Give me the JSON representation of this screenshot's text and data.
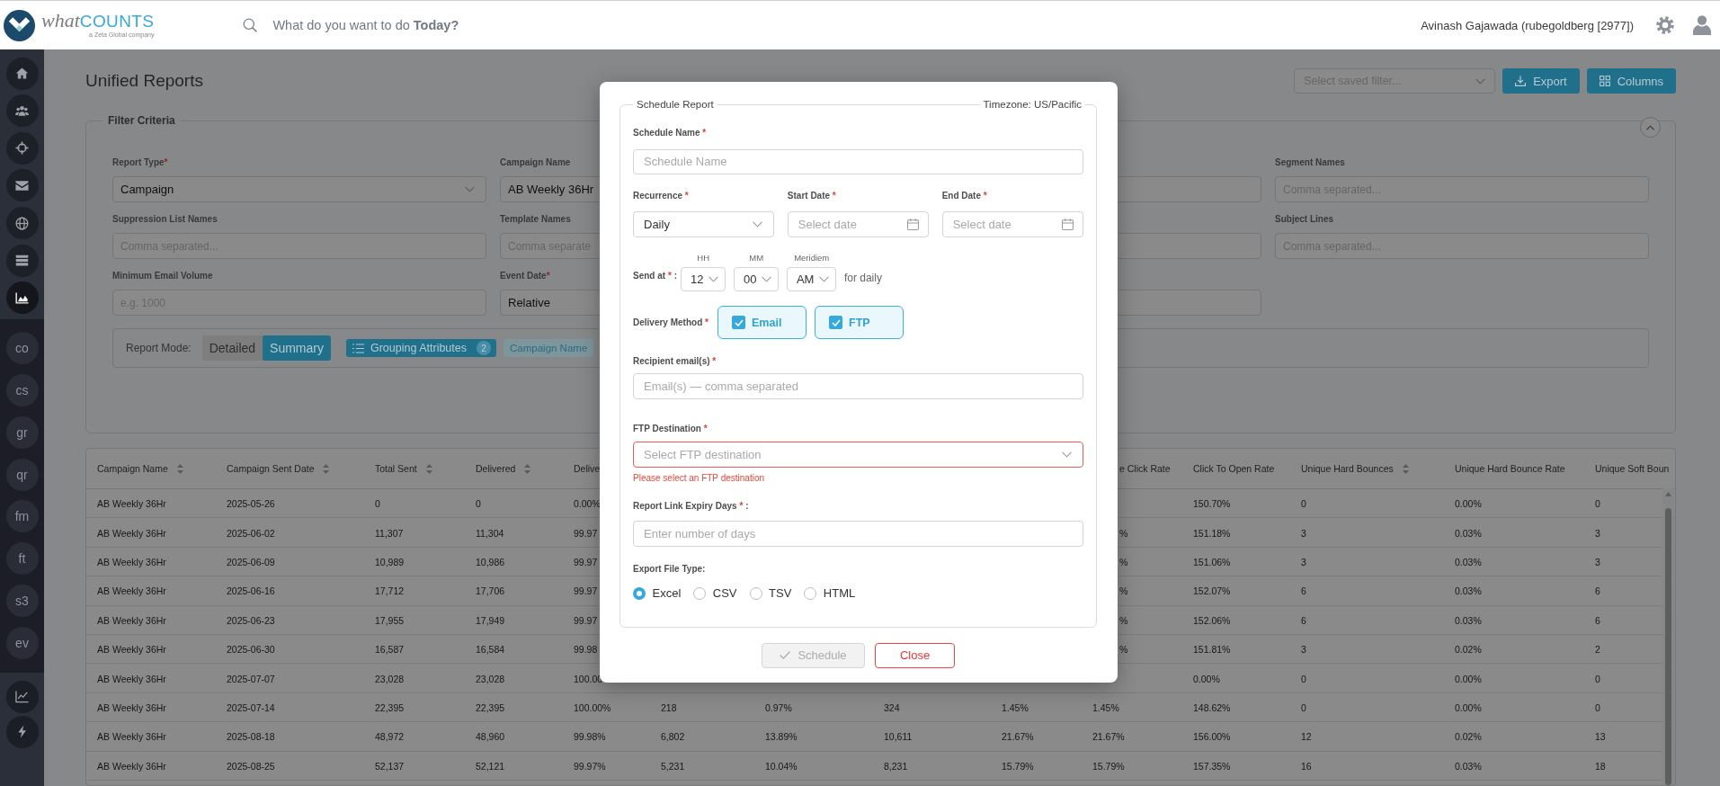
{
  "header": {
    "logo": {
      "wordmark": [
        "what",
        "COUNTS"
      ],
      "tagline": "a Zeta Global company"
    },
    "search": {
      "placeholder": "What do you want to do **Today?**"
    },
    "user": "Avinash Gajawada (rubegoldberg [2977])"
  },
  "sidebar": {
    "icon_items": [
      {
        "selected": false
      },
      {
        "selected": false
      },
      {
        "selected": false
      },
      {
        "selected": false
      },
      {
        "selected": false
      },
      {
        "selected": false
      },
      {
        "selected": true
      }
    ],
    "text_items": [
      {
        "label": "co",
        "selected": false
      },
      {
        "label": "cs",
        "selected": false
      },
      {
        "label": "gr",
        "selected": false
      },
      {
        "label": "qr",
        "selected": false
      },
      {
        "label": "fm",
        "selected": false
      },
      {
        "label": "ft",
        "selected": false
      },
      {
        "label": "s3",
        "selected": false
      },
      {
        "label": "ev",
        "selected": false
      }
    ],
    "bottom_items": [
      {
        "selected": false
      },
      {
        "selected": false
      }
    ]
  },
  "page": {
    "title": "Unified Reports",
    "saved_filter": {
      "placeholder": "Select saved filter..."
    },
    "buttons": [
      {
        "label": "Export",
        "kind": "export"
      },
      {
        "label": "Columns",
        "kind": "columns"
      }
    ]
  },
  "filter_criteria": {
    "legend": "Filter Criteria",
    "expanded": true,
    "fields": [
      {
        "kind": "select",
        "label": "Report Type",
        "mark": "*",
        "value": "Campaign"
      },
      {
        "kind": "input",
        "label": "Campaign Name",
        "value": "AB Weekly 36Hr"
      },
      {
        "kind": "input"
      },
      {
        "kind": "input",
        "label": "Segment Names",
        "placeholder": "Comma separated..."
      },
      {
        "kind": "input",
        "label": "Suppression List Names",
        "placeholder": "Comma separated..."
      },
      {
        "kind": "input",
        "label": "Template Names",
        "placeholder": "Comma separate"
      },
      {
        "kind": "select"
      },
      {
        "kind": "input",
        "label": "Subject Lines",
        "placeholder": "Comma separated..."
      },
      {
        "kind": "input",
        "label": "Minimum Email Volume",
        "placeholder": "e.g. 1000"
      },
      {
        "kind": "input",
        "label": "Event Date",
        "mark": "*",
        "value": "Relative"
      },
      {
        "kind": "input"
      }
    ],
    "report_mode": {
      "label": "Report Mode:",
      "options": [
        {
          "label": "Detailed",
          "selected": false
        },
        {
          "label": "Summary",
          "selected": true
        }
      ]
    },
    "grouping": {
      "label": "Grouping Attributes",
      "count": "2"
    },
    "chips": [
      "Campaign Name"
    ]
  },
  "table": {
    "columns": [
      {
        "label": "Campaign Name",
        "sortable": true
      },
      {
        "label": "Campaign Sent Date",
        "sortable": true
      },
      {
        "label": "Total Sent",
        "sortable": true
      },
      {
        "label": "Delivered",
        "sortable": true
      },
      {
        "label": "Delive",
        "sortable": false
      },
      null,
      null,
      null,
      null,
      {
        "label": "e Click Rate",
        "sortable": false
      },
      {
        "label": "Click To Open Rate",
        "sortable": false
      },
      {
        "label": "Unique Hard Bounces",
        "sortable": true
      },
      {
        "label": "Unique Hard Bounce Rate",
        "sortable": false
      },
      {
        "label": "Unique Soft Boun",
        "sortable": false
      }
    ],
    "rows": [
      [
        "AB Weekly 36Hr",
        "2025-05-26",
        "0",
        "0",
        "0.00%",
        null,
        null,
        null,
        null,
        null,
        "150.70%",
        "0",
        "0.00%",
        "0"
      ],
      [
        "AB Weekly 36Hr",
        "2025-06-02",
        "11,307",
        "11,304",
        "99.97",
        null,
        null,
        null,
        null,
        "%",
        "151.18%",
        "3",
        "0.03%",
        "3"
      ],
      [
        "AB Weekly 36Hr",
        "2025-06-09",
        "10,989",
        "10,986",
        "99.97",
        null,
        null,
        null,
        null,
        "%",
        "151.06%",
        "3",
        "0.03%",
        "3"
      ],
      [
        "AB Weekly 36Hr",
        "2025-06-16",
        "17,712",
        "17,706",
        "99.97",
        null,
        null,
        null,
        null,
        "%",
        "152.07%",
        "6",
        "0.03%",
        "6"
      ],
      [
        "AB Weekly 36Hr",
        "2025-06-23",
        "17,955",
        "17,949",
        "99.97",
        null,
        null,
        null,
        null,
        "%",
        "152.06%",
        "6",
        "0.03%",
        "6"
      ],
      [
        "AB Weekly 36Hr",
        "2025-06-30",
        "16,587",
        "16,584",
        "99.98",
        null,
        null,
        null,
        null,
        "%",
        "151.81%",
        "3",
        "0.02%",
        "2"
      ],
      [
        "AB Weekly 36Hr",
        "2025-07-07",
        "23,028",
        "23,028",
        "100.00",
        null,
        null,
        null,
        null,
        null,
        "0.00%",
        "0",
        "0.00%",
        "0"
      ],
      [
        "AB Weekly 36Hr",
        "2025-07-14",
        "22,395",
        "22,395",
        "100.00%",
        "218",
        "0.97%",
        "324",
        "1.45%",
        "1.45%",
        "148.62%",
        "0",
        "0.00%",
        "0"
      ],
      [
        "AB Weekly 36Hr",
        "2025-08-18",
        "48,972",
        "48,960",
        "99.98%",
        "6,802",
        "13.89%",
        "10,611",
        "21.67%",
        "21.67%",
        "156.00%",
        "12",
        "0.02%",
        "13"
      ],
      [
        "AB Weekly 36Hr",
        "2025-08-25",
        "52,137",
        "52,121",
        "99.97%",
        "5,231",
        "10.04%",
        "8,231",
        "15.79%",
        "15.79%",
        "157.35%",
        "16",
        "0.03%",
        "18"
      ]
    ]
  },
  "schedule_modal": {
    "title": "Schedule Report",
    "timezone": "Timezone: US/Pacific",
    "schedule_name": {
      "label": "Schedule Name",
      "mark": "*",
      "placeholder": "Schedule Name"
    },
    "recurrence": {
      "label": "Recurrence",
      "mark": "*",
      "value": "Daily"
    },
    "start_date": {
      "label": "Start Date",
      "mark": "*",
      "placeholder": "Select date"
    },
    "end_date": {
      "label": "End Date",
      "mark": "*",
      "placeholder": "Select date"
    },
    "send_at": {
      "label": "Send at",
      "mark": "*",
      "suffix": ":",
      "selects": [
        {
          "caption": "HH",
          "value": "12"
        },
        {
          "caption": "MM",
          "value": "00"
        },
        {
          "caption": "Meridiem",
          "value": "AM"
        }
      ],
      "note": "for daily"
    },
    "delivery_method": {
      "label": "Delivery Method",
      "mark": "*",
      "options": [
        {
          "label": "Email",
          "checked": true
        },
        {
          "label": "FTP",
          "checked": true
        }
      ]
    },
    "recipients": {
      "label": "Recipient email(s)",
      "mark": "*",
      "placeholder": "Email(s) — comma separated"
    },
    "ftp_destination": {
      "label": "FTP Destination",
      "mark": "*",
      "placeholder": "Select FTP destination",
      "invalid": true,
      "error": "Please select an FTP destination"
    },
    "link_expiry": {
      "label": "Report Link Expiry Days",
      "mark": "*",
      "suffix": ":",
      "placeholder": "Enter number of days"
    },
    "export_file_type": {
      "label": "Export File Type:",
      "options": [
        {
          "label": "Excel",
          "selected": true
        },
        {
          "label": "CSV",
          "selected": false
        },
        {
          "label": "TSV",
          "selected": false
        },
        {
          "label": "HTML",
          "selected": false
        }
      ]
    },
    "buttons": [
      {
        "label": "Schedule",
        "kind": "submit",
        "disabled": true
      },
      {
        "label": "Close",
        "kind": "cancel",
        "disabled": false
      }
    ]
  }
}
